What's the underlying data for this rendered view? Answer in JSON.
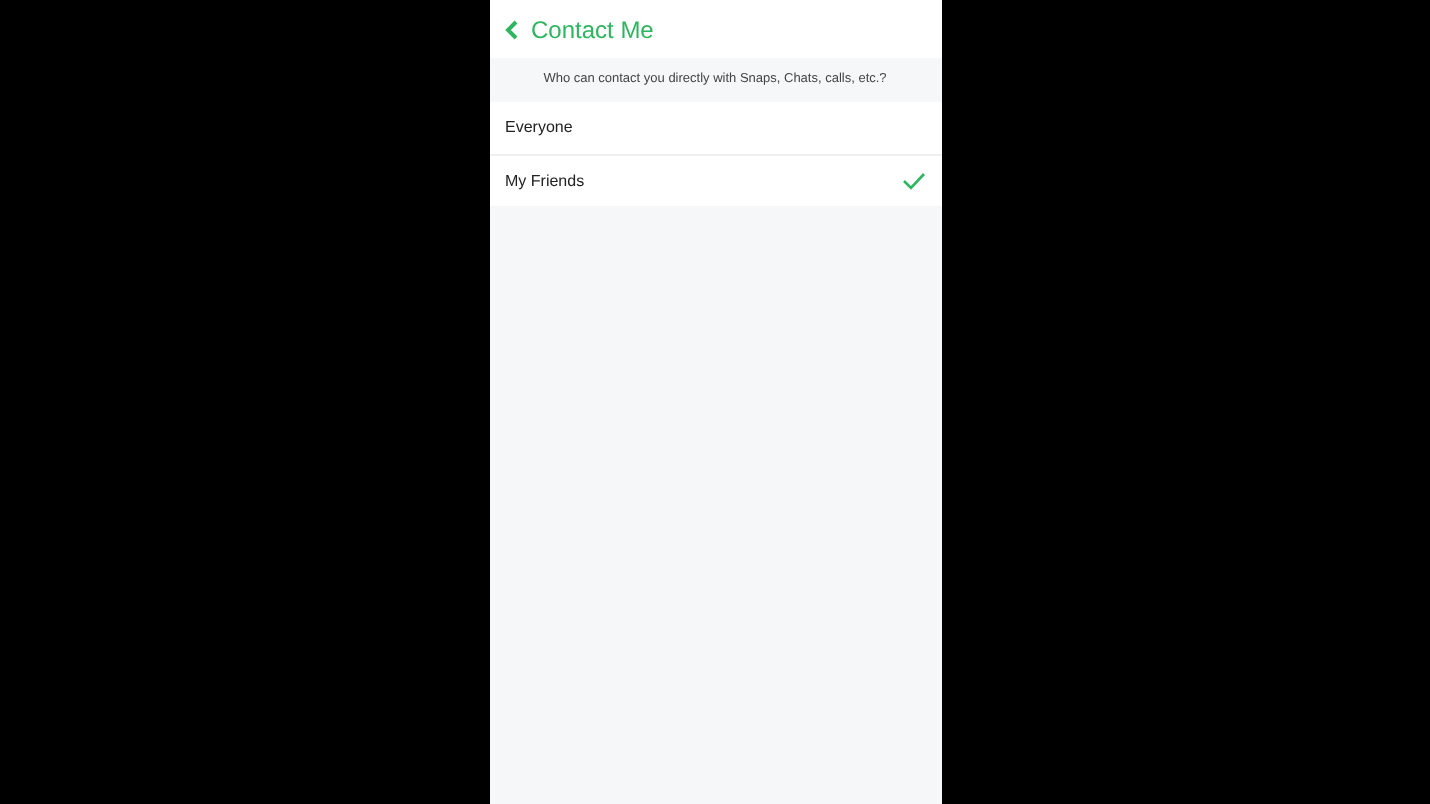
{
  "header": {
    "title": "Contact Me"
  },
  "question": "Who can contact you directly with Snaps, Chats, calls, etc.?",
  "options": [
    {
      "label": "Everyone",
      "selected": false
    },
    {
      "label": "My Friends",
      "selected": true
    }
  ]
}
